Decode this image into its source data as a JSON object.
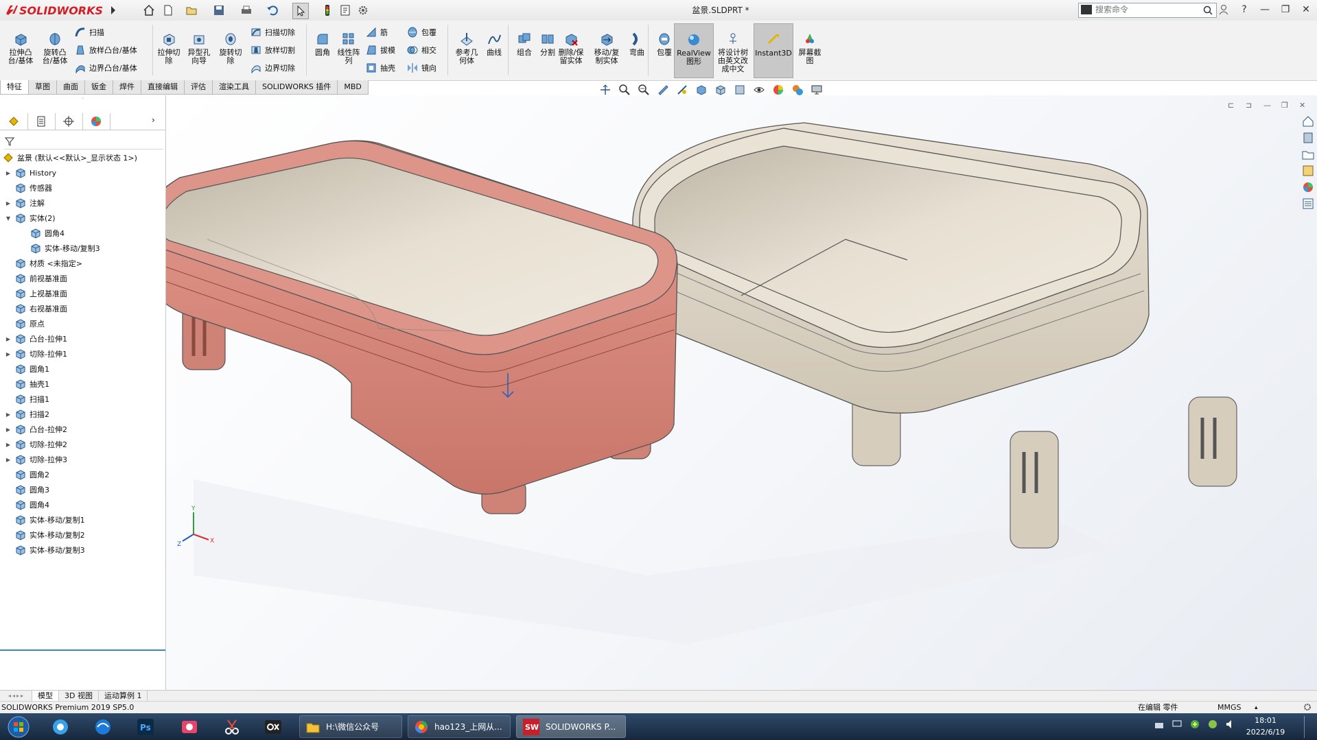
{
  "app": {
    "logo_text": "SOLIDWORKS",
    "doc_title": "盆景.SLDPRT *",
    "search_placeholder": "搜索命令",
    "help": "?"
  },
  "ribbon": {
    "boss_extrude": "拉伸凸\n台/基体",
    "revolve_boss": "旋转凸\n台/基体",
    "sweep": "扫描",
    "loft": "放样凸台/基体",
    "boundary_boss": "边界凸台/基体",
    "extruded_cut": "拉伸切\n除",
    "hole_wizard": "异型孔\n向导",
    "revolved_cut": "旋转切\n除",
    "swept_cut": "扫描切除",
    "lofted_cut": "放样切割",
    "boundary_cut": "边界切除",
    "fillet": "圆角",
    "linear_pattern": "线性阵\n列",
    "rib": "筋",
    "draft": "拔模",
    "shell": "抽壳",
    "wrap": "包覆",
    "intersect": "相交",
    "mirror": "镜向",
    "ref_geometry": "参考几\n何体",
    "curves": "曲线",
    "combine": "组合",
    "split": "分割",
    "delete_keep": "删除/保\n留实体",
    "move_copy": "移动/复\n制实体",
    "flex": "弯曲",
    "wrap2": "包覆",
    "realview": "RealView\n图形",
    "translate": "将设计树\n由英文改\n成中文",
    "instant3d": "Instant3D",
    "screenshot": "屏幕截\n图"
  },
  "tabs": [
    "特征",
    "草图",
    "曲面",
    "钣金",
    "焊件",
    "直接编辑",
    "评估",
    "渲染工具",
    "SOLIDWORKS 插件",
    "MBD"
  ],
  "tree": {
    "root": "盆景 (默认<<默认>_显示状态 1>)",
    "items": [
      {
        "label": "History",
        "level": 1,
        "expand": "▶"
      },
      {
        "label": "传感器",
        "level": 1,
        "expand": ""
      },
      {
        "label": "注解",
        "level": 1,
        "expand": "▶"
      },
      {
        "label": "实体(2)",
        "level": 1,
        "expand": "▼"
      },
      {
        "label": "圆角4",
        "level": 2,
        "expand": ""
      },
      {
        "label": "实体-移动/复制3",
        "level": 2,
        "expand": ""
      },
      {
        "label": "材质 <未指定>",
        "level": 1,
        "expand": ""
      },
      {
        "label": "前视基准面",
        "level": 1,
        "expand": ""
      },
      {
        "label": "上视基准面",
        "level": 1,
        "expand": ""
      },
      {
        "label": "右视基准面",
        "level": 1,
        "expand": ""
      },
      {
        "label": "原点",
        "level": 1,
        "expand": ""
      },
      {
        "label": "凸台-拉伸1",
        "level": 1,
        "expand": "▶"
      },
      {
        "label": "切除-拉伸1",
        "level": 1,
        "expand": "▶"
      },
      {
        "label": "圆角1",
        "level": 1,
        "expand": ""
      },
      {
        "label": "抽壳1",
        "level": 1,
        "expand": ""
      },
      {
        "label": "扫描1",
        "level": 1,
        "expand": ""
      },
      {
        "label": "扫描2",
        "level": 1,
        "expand": "▶"
      },
      {
        "label": "凸台-拉伸2",
        "level": 1,
        "expand": "▶"
      },
      {
        "label": "切除-拉伸2",
        "level": 1,
        "expand": "▶"
      },
      {
        "label": "切除-拉伸3",
        "level": 1,
        "expand": "▶"
      },
      {
        "label": "圆角2",
        "level": 1,
        "expand": ""
      },
      {
        "label": "圆角3",
        "level": 1,
        "expand": ""
      },
      {
        "label": "圆角4",
        "level": 1,
        "expand": ""
      },
      {
        "label": "实体-移动/复制1",
        "level": 1,
        "expand": ""
      },
      {
        "label": "实体-移动/复制2",
        "level": 1,
        "expand": ""
      },
      {
        "label": "实体-移动/复制3",
        "level": 1,
        "expand": ""
      }
    ]
  },
  "bottom_tabs": [
    "模型",
    "3D 视图",
    "运动算例 1"
  ],
  "status": {
    "product": "SOLIDWORKS Premium 2019 SP5.0",
    "mode": "在编辑 零件",
    "units": "MMGS"
  },
  "taskbar": {
    "window1": "H:\\微信公众号",
    "window2": "hao123_上网从...",
    "window3": "SOLIDWORKS P...",
    "time": "18:01",
    "date": "2022/6/19"
  },
  "triad": {
    "x": "X",
    "y": "Y",
    "z": "Z"
  },
  "colors": {
    "accent": "#d21f26",
    "pot_left": "#d98478",
    "pot_right": "#ddd5c6",
    "inner": "#e4dccc"
  }
}
